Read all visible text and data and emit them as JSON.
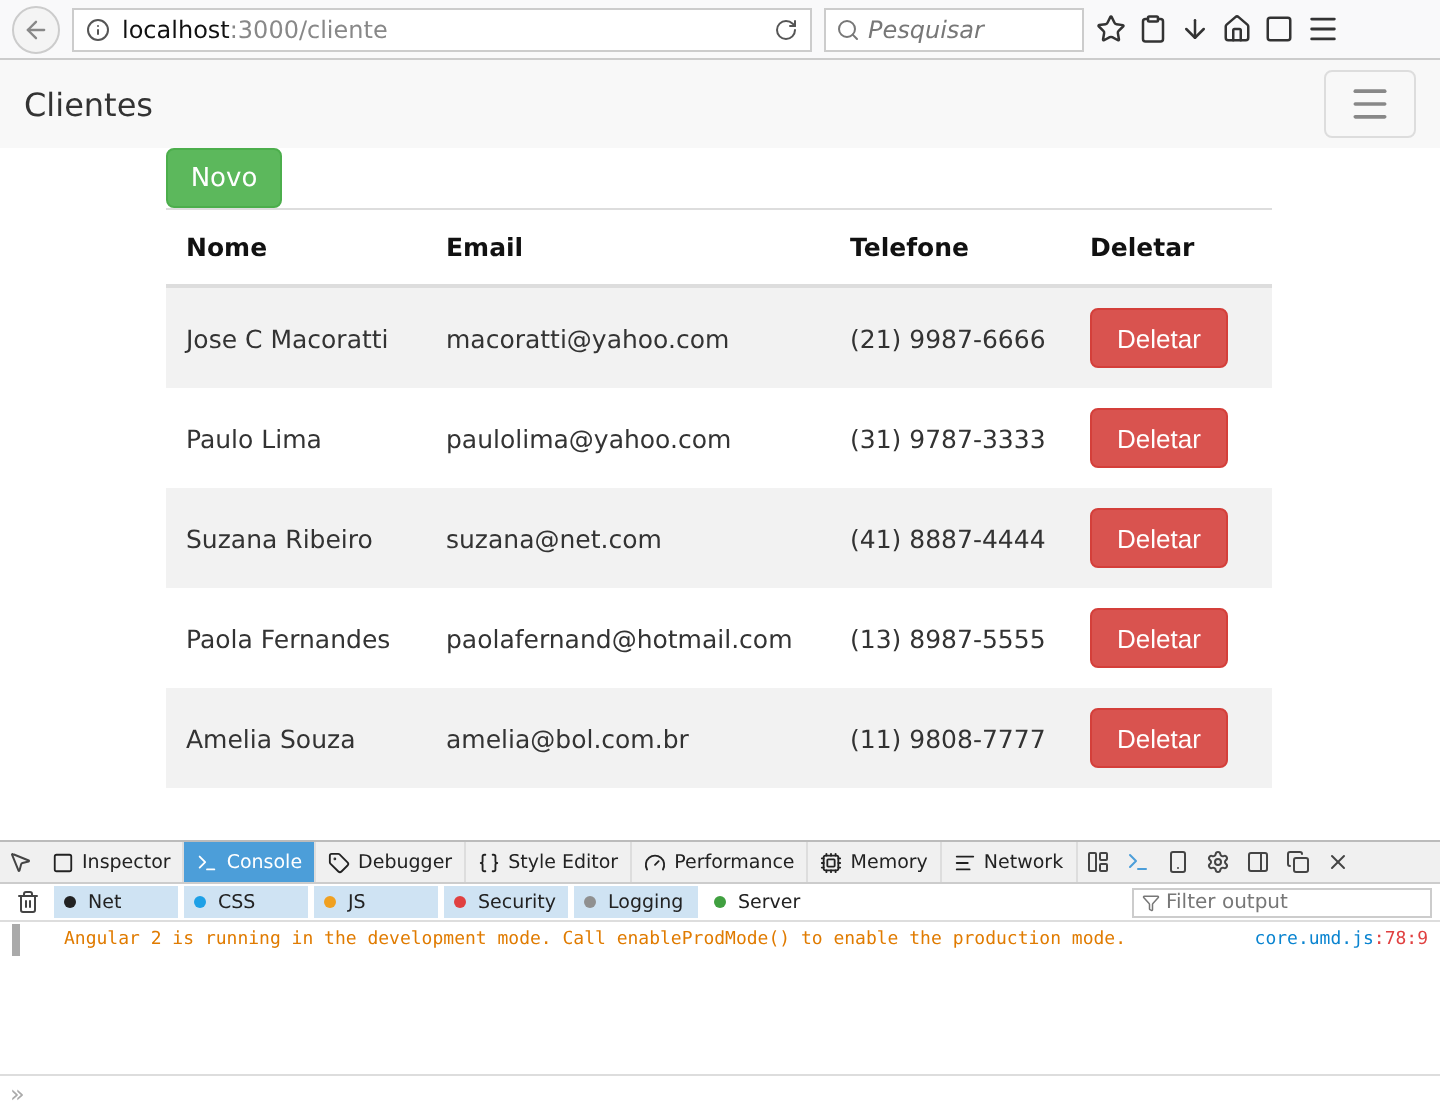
{
  "browser": {
    "url_host": "localhost",
    "url_path": ":3000/cliente",
    "search_placeholder": "Pesquisar"
  },
  "navbar": {
    "brand": "Clientes"
  },
  "new_button": "Novo",
  "table": {
    "columns": [
      "Nome",
      "Email",
      "Telefone",
      "Deletar"
    ],
    "rows": [
      {
        "name": "Jose C Macoratti",
        "email": "macoratti@yahoo.com",
        "phone": "(21) 9987-6666",
        "action": "Deletar"
      },
      {
        "name": "Paulo Lima",
        "email": "paulolima@yahoo.com",
        "phone": "(31) 9787-3333",
        "action": "Deletar"
      },
      {
        "name": "Suzana Ribeiro",
        "email": "suzana@net.com",
        "phone": "(41) 8887-4444",
        "action": "Deletar"
      },
      {
        "name": "Paola Fernandes",
        "email": "paolafernand@hotmail.com",
        "phone": "(13) 8987-5555",
        "action": "Deletar"
      },
      {
        "name": "Amelia Souza",
        "email": "amelia@bol.com.br",
        "phone": "(11) 9808-7777",
        "action": "Deletar"
      }
    ]
  },
  "devtools": {
    "tabs": [
      {
        "label": "Inspector",
        "selected": false
      },
      {
        "label": "Console",
        "selected": true
      },
      {
        "label": "Debugger",
        "selected": false
      },
      {
        "label": "Style Editor",
        "selected": false
      },
      {
        "label": "Performance",
        "selected": false
      },
      {
        "label": "Memory",
        "selected": false
      },
      {
        "label": "Network",
        "selected": false
      }
    ],
    "filters": [
      {
        "label": "Net",
        "color": "#222222",
        "selected": true
      },
      {
        "label": "CSS",
        "color": "#1ea0e6",
        "selected": true
      },
      {
        "label": "JS",
        "color": "#f0a020",
        "selected": true
      },
      {
        "label": "Security",
        "color": "#e04040",
        "selected": true
      },
      {
        "label": "Logging",
        "color": "#909090",
        "selected": true
      },
      {
        "label": "Server",
        "color": "#40a040",
        "selected": false
      }
    ],
    "filter_placeholder": "Filter output",
    "messages": [
      {
        "text": "Angular 2 is running in the development mode. Call enableProdMode() to enable the production mode.",
        "source": "core.umd.js",
        "location": ":78:9"
      }
    ],
    "prompt": "»"
  }
}
